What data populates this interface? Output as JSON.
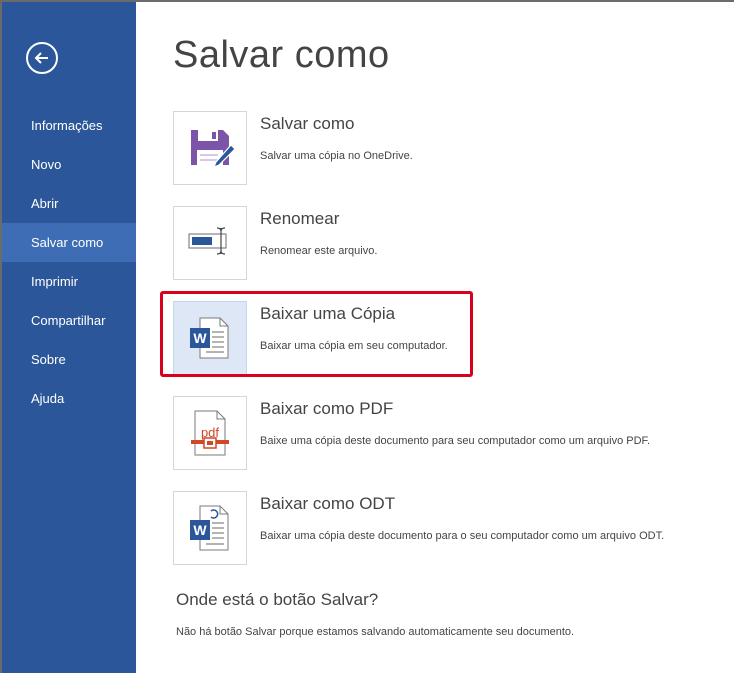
{
  "sidebar": {
    "back_icon": "back-arrow-icon",
    "items": [
      {
        "label": "Informações"
      },
      {
        "label": "Novo"
      },
      {
        "label": "Abrir"
      },
      {
        "label": "Salvar como",
        "active": true
      },
      {
        "label": "Imprimir"
      },
      {
        "label": "Compartilhar"
      },
      {
        "label": "Sobre"
      },
      {
        "label": "Ajuda"
      }
    ]
  },
  "main": {
    "title": "Salvar como",
    "options": [
      {
        "title": "Salvar como",
        "description": "Salvar uma cópia no OneDrive.",
        "icon": "save-as-icon"
      },
      {
        "title": "Renomear",
        "description": "Renomear este arquivo.",
        "icon": "rename-icon"
      },
      {
        "title": "Baixar uma Cópia",
        "description": "Baixar uma cópia em seu computador.",
        "icon": "word-document-icon",
        "highlighted": true
      },
      {
        "title": "Baixar como PDF",
        "description": "Baixe uma cópia deste documento para seu computador como um arquivo PDF.",
        "icon": "pdf-icon",
        "icon_text": "pdf"
      },
      {
        "title": "Baixar como ODT",
        "description": "Baixar uma cópia deste documento para o seu computador como um arquivo ODT.",
        "icon": "odt-document-icon"
      }
    ],
    "help": {
      "question": "Onde está o botão Salvar?",
      "answer": "Não há botão Salvar porque estamos salvando automaticamente seu documento."
    }
  },
  "colors": {
    "sidebar_bg": "#2b579a",
    "sidebar_active": "#3e6db5",
    "highlight_border": "#d9001b",
    "word_blue": "#2b579a",
    "save_purple": "#7c54a8",
    "pdf_orange": "#d24726"
  }
}
